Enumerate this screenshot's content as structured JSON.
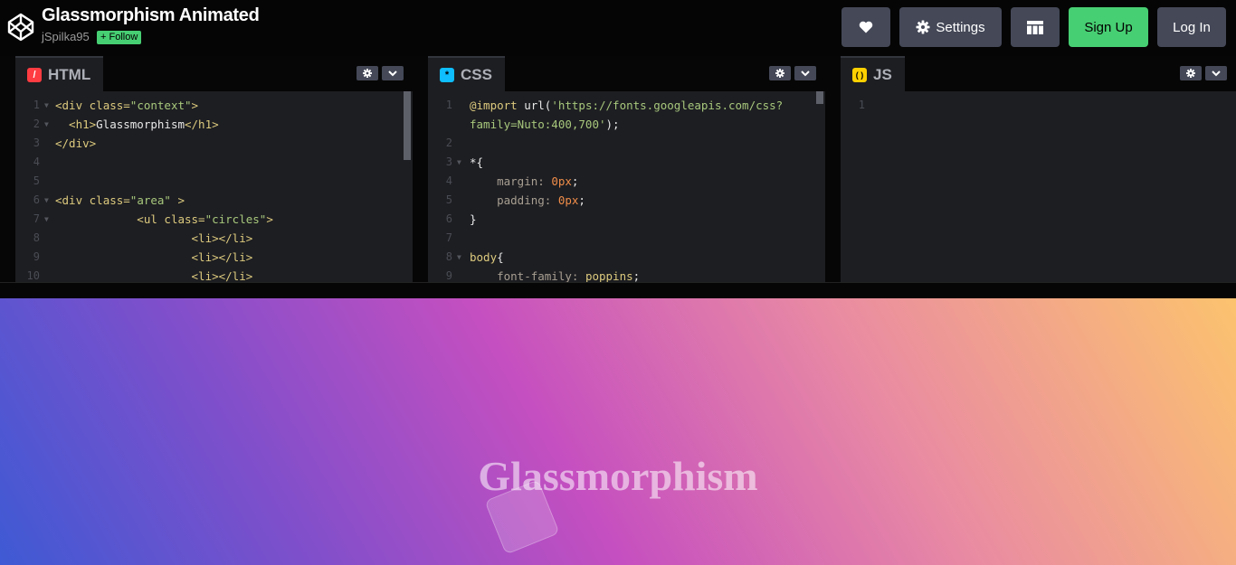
{
  "header": {
    "title": "Glassmorphism Animated",
    "author": "jSpilka95",
    "follow_label": "+ Follow",
    "settings_label": "Settings",
    "signup_label": "Sign Up",
    "login_label": "Log In"
  },
  "editors": {
    "html": {
      "label": "HTML",
      "badge": "/",
      "lines": [
        {
          "n": "1",
          "parts": [
            [
              "t-tag",
              "<div "
            ],
            [
              "t-attr",
              "class="
            ],
            [
              "t-str",
              "\"context\""
            ],
            [
              "t-tag",
              ">"
            ]
          ]
        },
        {
          "n": "2",
          "parts": [
            [
              "t-tag",
              "  <h1>"
            ],
            [
              "t-text",
              "Glassmorphism"
            ],
            [
              "t-tag",
              "</h1>"
            ]
          ]
        },
        {
          "n": "3",
          "parts": [
            [
              "t-tag",
              "</div>"
            ]
          ]
        },
        {
          "n": "4",
          "parts": []
        },
        {
          "n": "5",
          "parts": []
        },
        {
          "n": "6",
          "parts": [
            [
              "t-tag",
              "<div "
            ],
            [
              "t-attr",
              "class="
            ],
            [
              "t-str",
              "\"area\""
            ],
            [
              "t-tag",
              " >"
            ]
          ]
        },
        {
          "n": "7",
          "parts": [
            [
              "t-tag",
              "            <ul "
            ],
            [
              "t-attr",
              "class="
            ],
            [
              "t-str",
              "\"circles\""
            ],
            [
              "t-tag",
              ">"
            ]
          ]
        },
        {
          "n": "8",
          "parts": [
            [
              "t-tag",
              "                    <li></li>"
            ]
          ]
        },
        {
          "n": "9",
          "parts": [
            [
              "t-tag",
              "                    <li></li>"
            ]
          ]
        },
        {
          "n": "10",
          "parts": [
            [
              "t-tag",
              "                    <li></li>"
            ]
          ]
        }
      ]
    },
    "css": {
      "label": "CSS",
      "badge": "*",
      "lines": [
        {
          "n": "1",
          "parts": [
            [
              "t-kw",
              "@import "
            ],
            [
              "t-plain",
              "url("
            ],
            [
              "t-str",
              "'https://fonts.googleapis.com/css?"
            ]
          ]
        },
        {
          "n": "",
          "parts": [
            [
              "t-str",
              "family=Nuto:400,700'"
            ],
            [
              "t-plain",
              ");"
            ]
          ]
        },
        {
          "n": "2",
          "parts": []
        },
        {
          "n": "3",
          "parts": [
            [
              "t-plain",
              "*{"
            ]
          ]
        },
        {
          "n": "4",
          "parts": [
            [
              "t-prop",
              "    margin: "
            ],
            [
              "t-num",
              "0px"
            ],
            [
              "t-plain",
              ";"
            ]
          ]
        },
        {
          "n": "5",
          "parts": [
            [
              "t-prop",
              "    padding: "
            ],
            [
              "t-num",
              "0px"
            ],
            [
              "t-plain",
              ";"
            ]
          ]
        },
        {
          "n": "6",
          "parts": [
            [
              "t-plain",
              "}"
            ]
          ]
        },
        {
          "n": "7",
          "parts": []
        },
        {
          "n": "8",
          "parts": [
            [
              "t-kw",
              "body"
            ],
            [
              "t-plain",
              "{"
            ]
          ]
        },
        {
          "n": "9",
          "parts": [
            [
              "t-prop",
              "    font-family: "
            ],
            [
              "t-kw",
              "poppins"
            ],
            [
              "t-plain",
              ";"
            ]
          ]
        }
      ]
    },
    "js": {
      "label": "JS",
      "badge": "( )",
      "lines": [
        {
          "n": "1",
          "parts": []
        }
      ]
    }
  },
  "preview": {
    "heading": "Glassmorphism"
  },
  "colors": {
    "accent_green": "#47cf73",
    "button_gray": "#444857",
    "editor_bg": "#1d1e22",
    "html_badge": "#ff3c41",
    "css_badge": "#0ebeff",
    "js_badge": "#fcd000"
  }
}
